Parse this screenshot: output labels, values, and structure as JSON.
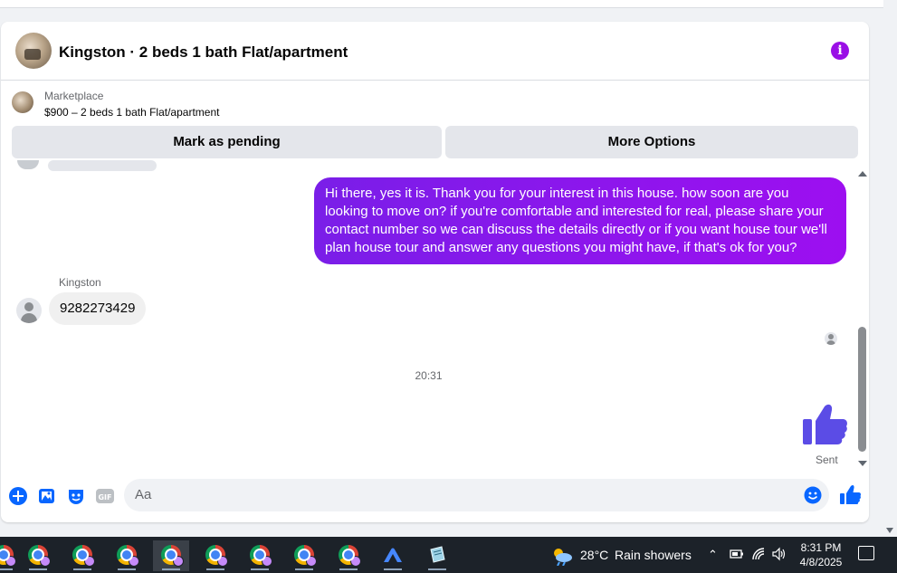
{
  "conversation": {
    "title": "Kingston · 2 beds 1 bath Flat/apartment",
    "info_icon": "info-icon"
  },
  "marketplace": {
    "label": "Marketplace",
    "listing": "$900 – 2 beds 1 bath Flat/apartment",
    "pending_button": "Mark as pending",
    "options_button": "More Options"
  },
  "messages": {
    "outgoing_text": "Hi there, yes it is. Thank you for your interest in this house. how soon are you looking to move on? if you're comfortable and interested for real, please share your contact number so we can discuss the details directly or if you want house tour we'll plan house tour and answer any questions you might have, if that's ok for you?",
    "sender_name": "Kingston",
    "incoming_text": "9282273429",
    "timestamp": "20:31",
    "sent_status": "Sent"
  },
  "composer": {
    "placeholder": "Aa"
  },
  "taskbar": {
    "temperature": "28°C",
    "weather": "Rain showers",
    "time": "8:31 PM",
    "date": "4/8/2025"
  },
  "colors": {
    "accent_purple": "#9a0fe6",
    "messenger_blue": "#0866ff",
    "like_indigo": "#5b4ce6"
  }
}
